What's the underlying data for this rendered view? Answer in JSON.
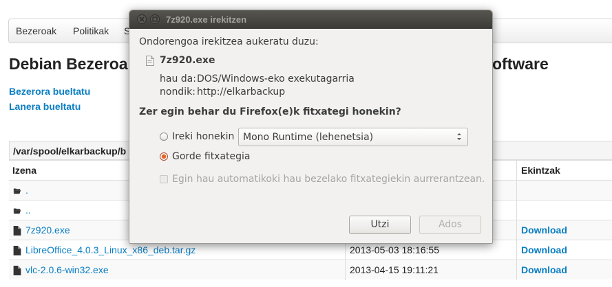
{
  "page": {
    "nav": [
      "Bezeroak",
      "Politikak",
      "S"
    ],
    "title_left": "Debian Bezeroa",
    "title_right": "oftware",
    "links": [
      "Bezerora bueltatu",
      "Lanera bueltatu"
    ],
    "path": "/var/spool/elkarbackup/b",
    "headers": {
      "name": "Izena",
      "actions": "Ekintzak"
    },
    "rows": [
      {
        "name": ".",
        "date": "",
        "action": "",
        "type": "folder"
      },
      {
        "name": "..",
        "date": "",
        "action": "",
        "type": "folder"
      },
      {
        "name": "7z920.exe",
        "date": "",
        "action": "Download",
        "type": "file"
      },
      {
        "name": "LibreOffice_4.0.3_Linux_x86_deb.tar.gz",
        "date": "2013-05-03 18:16:55",
        "action": "Download",
        "type": "file"
      },
      {
        "name": "vlc-2.0.6-win32.exe",
        "date": "2013-04-15 19:11:21",
        "action": "Download",
        "type": "file"
      }
    ]
  },
  "dialog": {
    "title": "7z920.exe irekitzen",
    "intro": "Ondorengoa irekitzea aukeratu duzu:",
    "filename": "7z920.exe",
    "type_label": "hau da:",
    "type_value": "DOS/Windows-eko exekutagarria",
    "from_label": "nondik:",
    "from_value": "http://elkarbackup",
    "question": "Zer egin behar du Firefox(e)k fitxategi honekin?",
    "open_with_label": "Ireki honekin",
    "open_with_app": "Mono Runtime (lehenetsia)",
    "save_label": "Gorde fitxategia",
    "save_selected": true,
    "auto_label": "Egin hau automatikoki hau bezelako fitxategiekin aurrerantzean.",
    "cancel_label": "Utzi",
    "ok_label": "Ados"
  },
  "colors": {
    "link": "#0a7ec4",
    "titlebar": "#3c3b37",
    "radio_accent": "#e6642d"
  }
}
